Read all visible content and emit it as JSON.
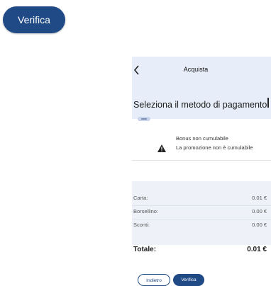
{
  "top_button": {
    "label": "Verifica"
  },
  "header": {
    "title": "Acquista",
    "back_icon": "chevron-left-icon"
  },
  "payment_method": {
    "title": "Seleziona il metodo di pagamento"
  },
  "bonus": {
    "title": "Bonus non cumulabile",
    "description": "La promozione non è cumulabile",
    "icon": "warning-icon"
  },
  "summary": {
    "rows": [
      {
        "label": "Carta:",
        "amount": "0.01 €"
      },
      {
        "label": "Borsellino:",
        "amount": "0.00 €"
      },
      {
        "label": "Sconti:",
        "amount": "0.00 €"
      }
    ],
    "total_label": "Totale:",
    "total_amount": "0.01 €"
  },
  "footer": {
    "back_label": "Indietro",
    "verify_label": "Verifica"
  },
  "colors": {
    "primary": "#1f4a86",
    "header_bg": "#e8eef9",
    "summary_bg": "#eef2f8"
  }
}
